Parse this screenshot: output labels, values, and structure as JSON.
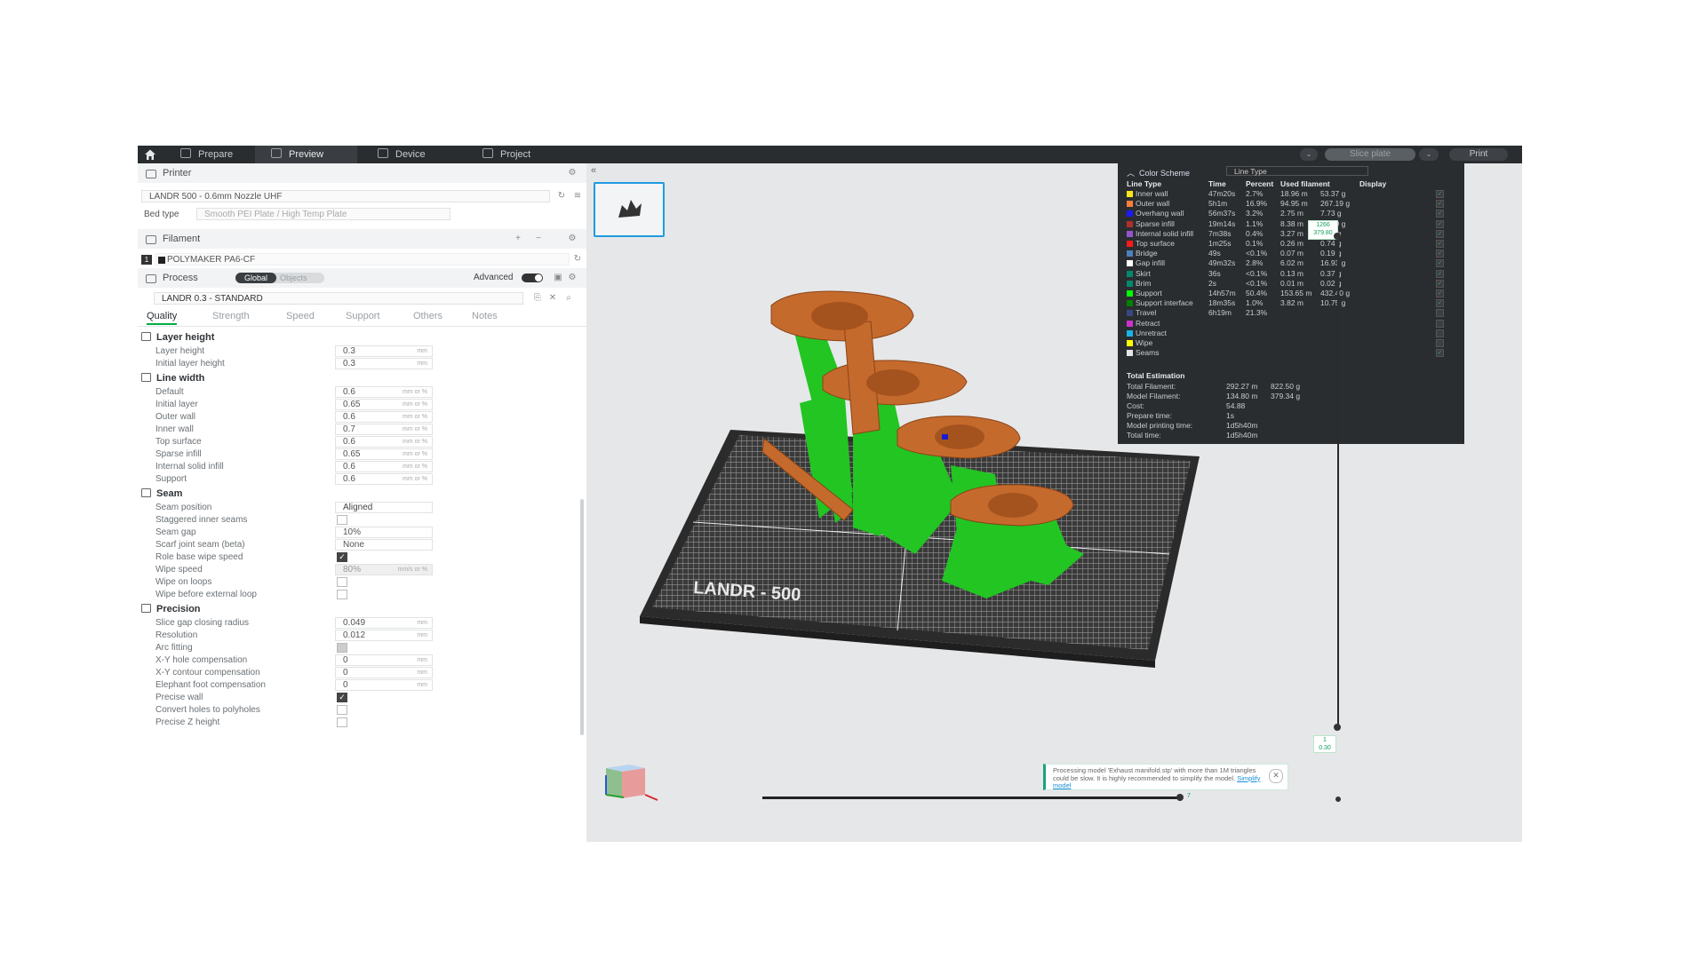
{
  "topbar": {
    "tabs": [
      {
        "label": "Prepare",
        "icon": "prepare-icon"
      },
      {
        "label": "Preview",
        "icon": "preview-icon"
      },
      {
        "label": "Device",
        "icon": "device-icon"
      },
      {
        "label": "Project",
        "icon": "project-icon"
      }
    ],
    "slice_label": "Slice plate",
    "print_label": "Print"
  },
  "printer": {
    "section_label": "Printer",
    "name": "LANDR 500 - 0.6mm Nozzle UHF",
    "bed_type_label": "Bed type",
    "bed_type": "Smooth PEI Plate / High Temp Plate"
  },
  "filament": {
    "section_label": "Filament",
    "slot": "1",
    "name": "POLYMAKER PA6-CF"
  },
  "process": {
    "section_label": "Process",
    "global_label": "Global",
    "objects_label": "Objects",
    "advanced_label": "Advanced",
    "profile": "LANDR 0.3 - STANDARD",
    "tabs": [
      "Quality",
      "Strength",
      "Speed",
      "Support",
      "Others",
      "Notes"
    ]
  },
  "quality": {
    "layer_height": {
      "title": "Layer height",
      "items": [
        {
          "label": "Layer height",
          "value": "0.3",
          "unit": "mm"
        },
        {
          "label": "Initial layer height",
          "value": "0.3",
          "unit": "mm"
        }
      ]
    },
    "line_width": {
      "title": "Line width",
      "items": [
        {
          "label": "Default",
          "value": "0.6",
          "unit": "mm or %"
        },
        {
          "label": "Initial layer",
          "value": "0.65",
          "unit": "mm or %"
        },
        {
          "label": "Outer wall",
          "value": "0.6",
          "unit": "mm or %"
        },
        {
          "label": "Inner wall",
          "value": "0.7",
          "unit": "mm or %"
        },
        {
          "label": "Top surface",
          "value": "0.6",
          "unit": "mm or %"
        },
        {
          "label": "Sparse infill",
          "value": "0.65",
          "unit": "mm or %"
        },
        {
          "label": "Internal solid infill",
          "value": "0.6",
          "unit": "mm or %"
        },
        {
          "label": "Support",
          "value": "0.6",
          "unit": "mm or %"
        }
      ]
    },
    "seam": {
      "title": "Seam",
      "seam_position_label": "Seam position",
      "seam_position": "Aligned",
      "staggered_label": "Staggered inner seams",
      "seam_gap_label": "Seam gap",
      "seam_gap": "10%",
      "scarf_label": "Scarf joint seam (beta)",
      "scarf": "None",
      "role_base_label": "Role base wipe speed",
      "wipe_speed_label": "Wipe speed",
      "wipe_speed": "80%",
      "wipe_speed_unit": "mm/s or %",
      "wipe_loops_label": "Wipe on loops",
      "wipe_before_label": "Wipe before external loop"
    },
    "precision": {
      "title": "Precision",
      "slice_gap_label": "Slice gap closing radius",
      "slice_gap": "0.049",
      "resolution_label": "Resolution",
      "resolution": "0.012",
      "arc_label": "Arc fitting",
      "xy_hole_label": "X-Y hole compensation",
      "xy_hole": "0",
      "xy_contour_label": "X-Y contour compensation",
      "xy_contour": "0",
      "elephant_label": "Elephant foot compensation",
      "elephant": "0",
      "precise_wall_label": "Precise wall",
      "convert_holes_label": "Convert holes to polyholes",
      "precise_z_label": "Precise Z height",
      "unit": "mm"
    }
  },
  "legend": {
    "title": "Color Scheme",
    "scheme": "Line Type",
    "headers": [
      "Line Type",
      "Time",
      "Percent",
      "Used filament",
      "Display"
    ],
    "rows": [
      {
        "name": "Inner wall",
        "color": "#ffe61a",
        "time": "47m20s",
        "pct": "2.7%",
        "len": "18.96 m",
        "wt": "53.37 g",
        "on": true
      },
      {
        "name": "Outer wall",
        "color": "#ff7d38",
        "time": "5h1m",
        "pct": "16.9%",
        "len": "94.95 m",
        "wt": "267.19 g",
        "on": true
      },
      {
        "name": "Overhang wall",
        "color": "#1a1aff",
        "time": "56m37s",
        "pct": "3.2%",
        "len": "2.75 m",
        "wt": "7.73 g",
        "on": true
      },
      {
        "name": "Sparse infill",
        "color": "#b03029",
        "time": "19m14s",
        "pct": "1.1%",
        "len": "8.38 m",
        "wt": "23.59 g",
        "on": true
      },
      {
        "name": "Internal solid infill",
        "color": "#9654cc",
        "time": "7m38s",
        "pct": "0.4%",
        "len": "3.27 m",
        "wt": "9.20 g",
        "on": true
      },
      {
        "name": "Top surface",
        "color": "#ff1a1a",
        "time": "1m25s",
        "pct": "0.1%",
        "len": "0.26 m",
        "wt": "0.74 g",
        "on": true
      },
      {
        "name": "Bridge",
        "color": "#4d80ba",
        "time": "49s",
        "pct": "<0.1%",
        "len": "0.07 m",
        "wt": "0.19 g",
        "on": true
      },
      {
        "name": "Gap infill",
        "color": "#ffffff",
        "time": "49m32s",
        "pct": "2.8%",
        "len": "6.02 m",
        "wt": "16.93 g",
        "on": true
      },
      {
        "name": "Skirt",
        "color": "#00876e",
        "time": "36s",
        "pct": "<0.1%",
        "len": "0.13 m",
        "wt": "0.37 g",
        "on": true
      },
      {
        "name": "Brim",
        "color": "#00876e",
        "time": "2s",
        "pct": "<0.1%",
        "len": "0.01 m",
        "wt": "0.02 g",
        "on": true
      },
      {
        "name": "Support",
        "color": "#00ff00",
        "time": "14h57m",
        "pct": "50.4%",
        "len": "153.65 m",
        "wt": "432.40 g",
        "on": true
      },
      {
        "name": "Support interface",
        "color": "#008000",
        "time": "18m35s",
        "pct": "1.0%",
        "len": "3.82 m",
        "wt": "10.75 g",
        "on": true
      },
      {
        "name": "Travel",
        "color": "#38487f",
        "time": "6h19m",
        "pct": "21.3%",
        "len": "",
        "wt": "",
        "on": false
      },
      {
        "name": "Retract",
        "color": "#cc33cc",
        "time": "",
        "pct": "",
        "len": "",
        "wt": "",
        "on": false
      },
      {
        "name": "Unretract",
        "color": "#1ab3e6",
        "time": "",
        "pct": "",
        "len": "",
        "wt": "",
        "on": false
      },
      {
        "name": "Wipe",
        "color": "#ffff00",
        "time": "",
        "pct": "",
        "len": "",
        "wt": "",
        "on": false
      },
      {
        "name": "Seams",
        "color": "#e6e6e6",
        "time": "",
        "pct": "",
        "len": "",
        "wt": "",
        "on": true
      }
    ],
    "totals_title": "Total Estimation",
    "total_filament_label": "Total Filament:",
    "total_filament_len": "292.27 m",
    "total_filament_wt": "822.50 g",
    "model_filament_label": "Model Filament:",
    "model_filament_len": "134.80 m",
    "model_filament_wt": "379.34 g",
    "cost_label": "Cost:",
    "cost": "54.88",
    "prepare_label": "Prepare time:",
    "prepare": "1s",
    "model_time_label": "Model printing time:",
    "model_time": "1d5h40m",
    "total_time_label": "Total time:",
    "total_time": "1d5h40m"
  },
  "slider": {
    "top_layer": "1266",
    "top_height": "379.80",
    "bottom_layer": "1",
    "bottom_height": "0.30",
    "h_value": "7"
  },
  "plate_brand": "LANDR - 500",
  "notification": {
    "text": "Processing model 'Exhaust manifold.stp' with more than 1M triangles could be slow. It is highly recommended to simplify the model.",
    "link": "Simplify model"
  },
  "colors": {
    "accent": "#00ae42",
    "model": "#c56a2d",
    "support": "#22cc22"
  }
}
